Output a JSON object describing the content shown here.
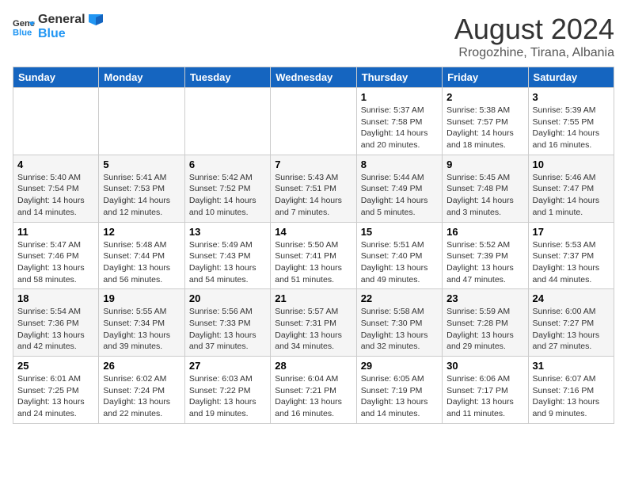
{
  "header": {
    "logo_general": "General",
    "logo_blue": "Blue",
    "month_title": "August 2024",
    "subtitle": "Rrogozhine, Tirana, Albania"
  },
  "weekdays": [
    "Sunday",
    "Monday",
    "Tuesday",
    "Wednesday",
    "Thursday",
    "Friday",
    "Saturday"
  ],
  "weeks": [
    [
      {
        "day": "",
        "info": ""
      },
      {
        "day": "",
        "info": ""
      },
      {
        "day": "",
        "info": ""
      },
      {
        "day": "",
        "info": ""
      },
      {
        "day": "1",
        "info": "Sunrise: 5:37 AM\nSunset: 7:58 PM\nDaylight: 14 hours\nand 20 minutes."
      },
      {
        "day": "2",
        "info": "Sunrise: 5:38 AM\nSunset: 7:57 PM\nDaylight: 14 hours\nand 18 minutes."
      },
      {
        "day": "3",
        "info": "Sunrise: 5:39 AM\nSunset: 7:55 PM\nDaylight: 14 hours\nand 16 minutes."
      }
    ],
    [
      {
        "day": "4",
        "info": "Sunrise: 5:40 AM\nSunset: 7:54 PM\nDaylight: 14 hours\nand 14 minutes."
      },
      {
        "day": "5",
        "info": "Sunrise: 5:41 AM\nSunset: 7:53 PM\nDaylight: 14 hours\nand 12 minutes."
      },
      {
        "day": "6",
        "info": "Sunrise: 5:42 AM\nSunset: 7:52 PM\nDaylight: 14 hours\nand 10 minutes."
      },
      {
        "day": "7",
        "info": "Sunrise: 5:43 AM\nSunset: 7:51 PM\nDaylight: 14 hours\nand 7 minutes."
      },
      {
        "day": "8",
        "info": "Sunrise: 5:44 AM\nSunset: 7:49 PM\nDaylight: 14 hours\nand 5 minutes."
      },
      {
        "day": "9",
        "info": "Sunrise: 5:45 AM\nSunset: 7:48 PM\nDaylight: 14 hours\nand 3 minutes."
      },
      {
        "day": "10",
        "info": "Sunrise: 5:46 AM\nSunset: 7:47 PM\nDaylight: 14 hours\nand 1 minute."
      }
    ],
    [
      {
        "day": "11",
        "info": "Sunrise: 5:47 AM\nSunset: 7:46 PM\nDaylight: 13 hours\nand 58 minutes."
      },
      {
        "day": "12",
        "info": "Sunrise: 5:48 AM\nSunset: 7:44 PM\nDaylight: 13 hours\nand 56 minutes."
      },
      {
        "day": "13",
        "info": "Sunrise: 5:49 AM\nSunset: 7:43 PM\nDaylight: 13 hours\nand 54 minutes."
      },
      {
        "day": "14",
        "info": "Sunrise: 5:50 AM\nSunset: 7:41 PM\nDaylight: 13 hours\nand 51 minutes."
      },
      {
        "day": "15",
        "info": "Sunrise: 5:51 AM\nSunset: 7:40 PM\nDaylight: 13 hours\nand 49 minutes."
      },
      {
        "day": "16",
        "info": "Sunrise: 5:52 AM\nSunset: 7:39 PM\nDaylight: 13 hours\nand 47 minutes."
      },
      {
        "day": "17",
        "info": "Sunrise: 5:53 AM\nSunset: 7:37 PM\nDaylight: 13 hours\nand 44 minutes."
      }
    ],
    [
      {
        "day": "18",
        "info": "Sunrise: 5:54 AM\nSunset: 7:36 PM\nDaylight: 13 hours\nand 42 minutes."
      },
      {
        "day": "19",
        "info": "Sunrise: 5:55 AM\nSunset: 7:34 PM\nDaylight: 13 hours\nand 39 minutes."
      },
      {
        "day": "20",
        "info": "Sunrise: 5:56 AM\nSunset: 7:33 PM\nDaylight: 13 hours\nand 37 minutes."
      },
      {
        "day": "21",
        "info": "Sunrise: 5:57 AM\nSunset: 7:31 PM\nDaylight: 13 hours\nand 34 minutes."
      },
      {
        "day": "22",
        "info": "Sunrise: 5:58 AM\nSunset: 7:30 PM\nDaylight: 13 hours\nand 32 minutes."
      },
      {
        "day": "23",
        "info": "Sunrise: 5:59 AM\nSunset: 7:28 PM\nDaylight: 13 hours\nand 29 minutes."
      },
      {
        "day": "24",
        "info": "Sunrise: 6:00 AM\nSunset: 7:27 PM\nDaylight: 13 hours\nand 27 minutes."
      }
    ],
    [
      {
        "day": "25",
        "info": "Sunrise: 6:01 AM\nSunset: 7:25 PM\nDaylight: 13 hours\nand 24 minutes."
      },
      {
        "day": "26",
        "info": "Sunrise: 6:02 AM\nSunset: 7:24 PM\nDaylight: 13 hours\nand 22 minutes."
      },
      {
        "day": "27",
        "info": "Sunrise: 6:03 AM\nSunset: 7:22 PM\nDaylight: 13 hours\nand 19 minutes."
      },
      {
        "day": "28",
        "info": "Sunrise: 6:04 AM\nSunset: 7:21 PM\nDaylight: 13 hours\nand 16 minutes."
      },
      {
        "day": "29",
        "info": "Sunrise: 6:05 AM\nSunset: 7:19 PM\nDaylight: 13 hours\nand 14 minutes."
      },
      {
        "day": "30",
        "info": "Sunrise: 6:06 AM\nSunset: 7:17 PM\nDaylight: 13 hours\nand 11 minutes."
      },
      {
        "day": "31",
        "info": "Sunrise: 6:07 AM\nSunset: 7:16 PM\nDaylight: 13 hours\nand 9 minutes."
      }
    ]
  ]
}
